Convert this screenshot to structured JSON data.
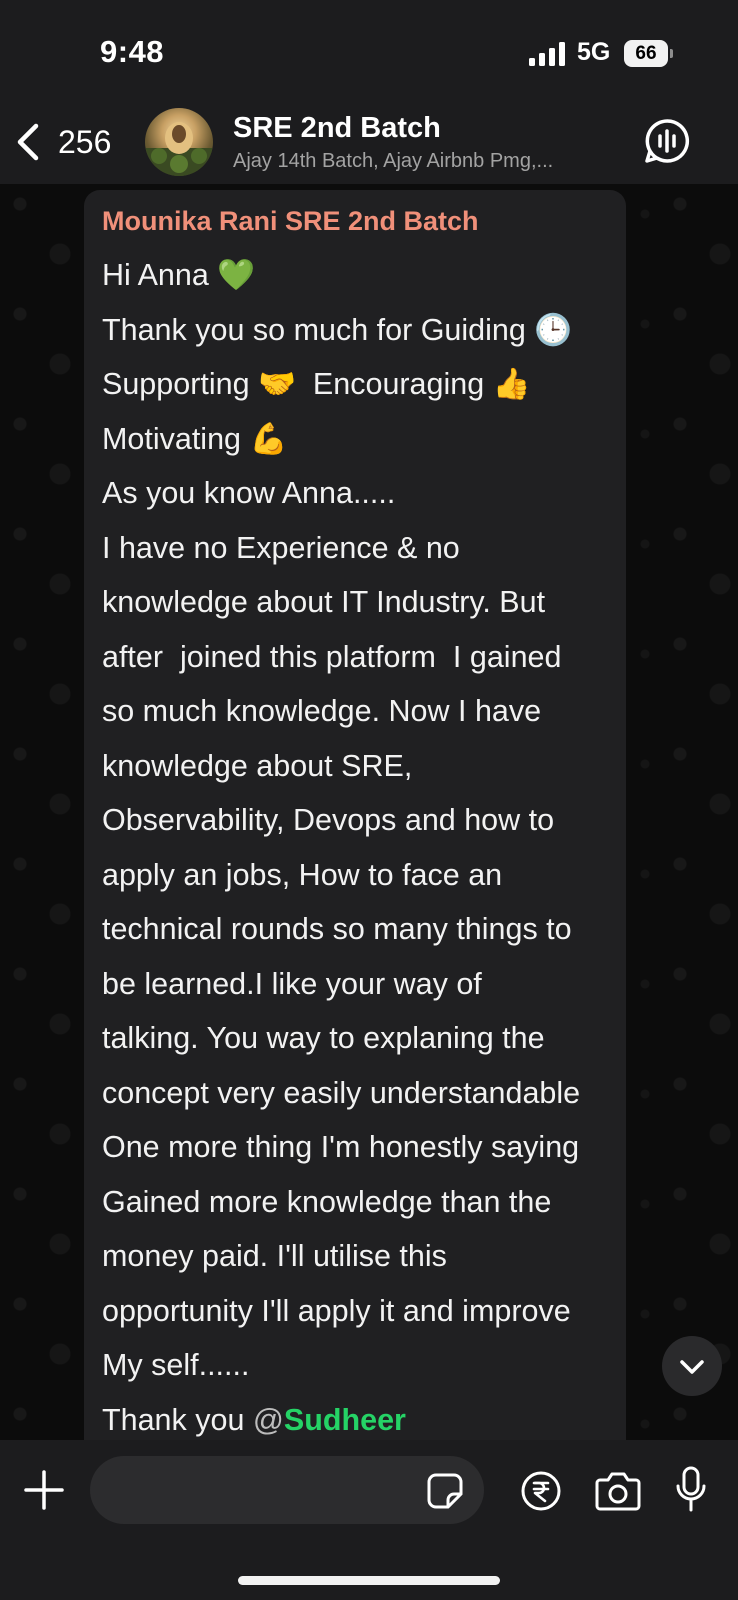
{
  "status_bar": {
    "time": "9:48",
    "network": "5G",
    "battery": "66"
  },
  "header": {
    "back_count": "256",
    "title": "SRE 2nd Batch",
    "subtitle": "Ajay 14th Batch, Ajay Airbnb Pmg,..."
  },
  "message": {
    "sender": "Mounika Rani SRE 2nd Batch",
    "lines": [
      "Hi Anna 💚",
      "Thank you so much for Guiding 🕒",
      "Supporting 🤝  Encouraging 👍",
      "Motivating 💪",
      "As you know Anna.....",
      "I have no Experience & no",
      "knowledge about IT Industry. But",
      "after  joined this platform  I gained",
      "so much knowledge. Now I have",
      "knowledge about SRE,",
      "Observability, Devops and how to",
      "apply an jobs, How to face an",
      "technical rounds so many things to",
      "be learned.I like your way of",
      "talking. You way to explaning the",
      "concept very easily understandable",
      "One more thing I'm honestly saying",
      "Gained more knowledge than the",
      "money paid. I'll utilise this",
      "opportunity I'll apply it and improve",
      "My self......"
    ],
    "last_line_prefix": "Thank you ",
    "mention_at": "@",
    "mention_name": "Sudheer"
  },
  "input": {
    "placeholder": ""
  },
  "colors": {
    "sender_name": "#f0907a",
    "mention": "#25d366",
    "bubble": "#202022",
    "bars": "#1c1c1e"
  }
}
